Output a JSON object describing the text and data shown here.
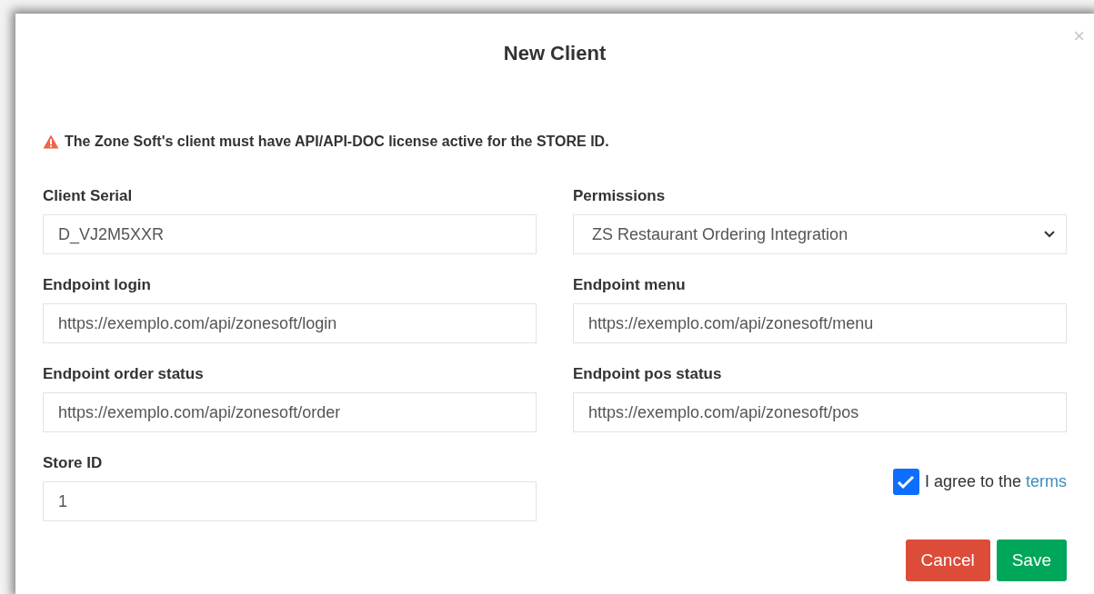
{
  "dialog": {
    "title": "New Client",
    "close": "×"
  },
  "warning": "The Zone Soft's client must have API/API-DOC license active for the STORE ID.",
  "fields": [
    {
      "kind": "input",
      "label": "Client Serial",
      "value": "D_VJ2M5XXR"
    },
    {
      "kind": "select",
      "label": "Permissions",
      "value": "ZS Restaurant Ordering Integration"
    },
    {
      "kind": "input",
      "label": "Endpoint login",
      "value": "https://exemplo.com/api/zonesoft/login"
    },
    {
      "kind": "input",
      "label": "Endpoint menu",
      "value": "https://exemplo.com/api/zonesoft/menu"
    },
    {
      "kind": "input",
      "label": "Endpoint order status",
      "value": "https://exemplo.com/api/zonesoft/order"
    },
    {
      "kind": "input",
      "label": "Endpoint pos status",
      "value": "https://exemplo.com/api/zonesoft/pos"
    },
    {
      "kind": "input",
      "label": "Store ID",
      "value": "1"
    }
  ],
  "agree": {
    "checked": true,
    "text": "I agree to the",
    "link": "terms"
  },
  "buttons": [
    {
      "kind": "danger",
      "label": "Cancel"
    },
    {
      "kind": "success",
      "label": "Save"
    }
  ]
}
